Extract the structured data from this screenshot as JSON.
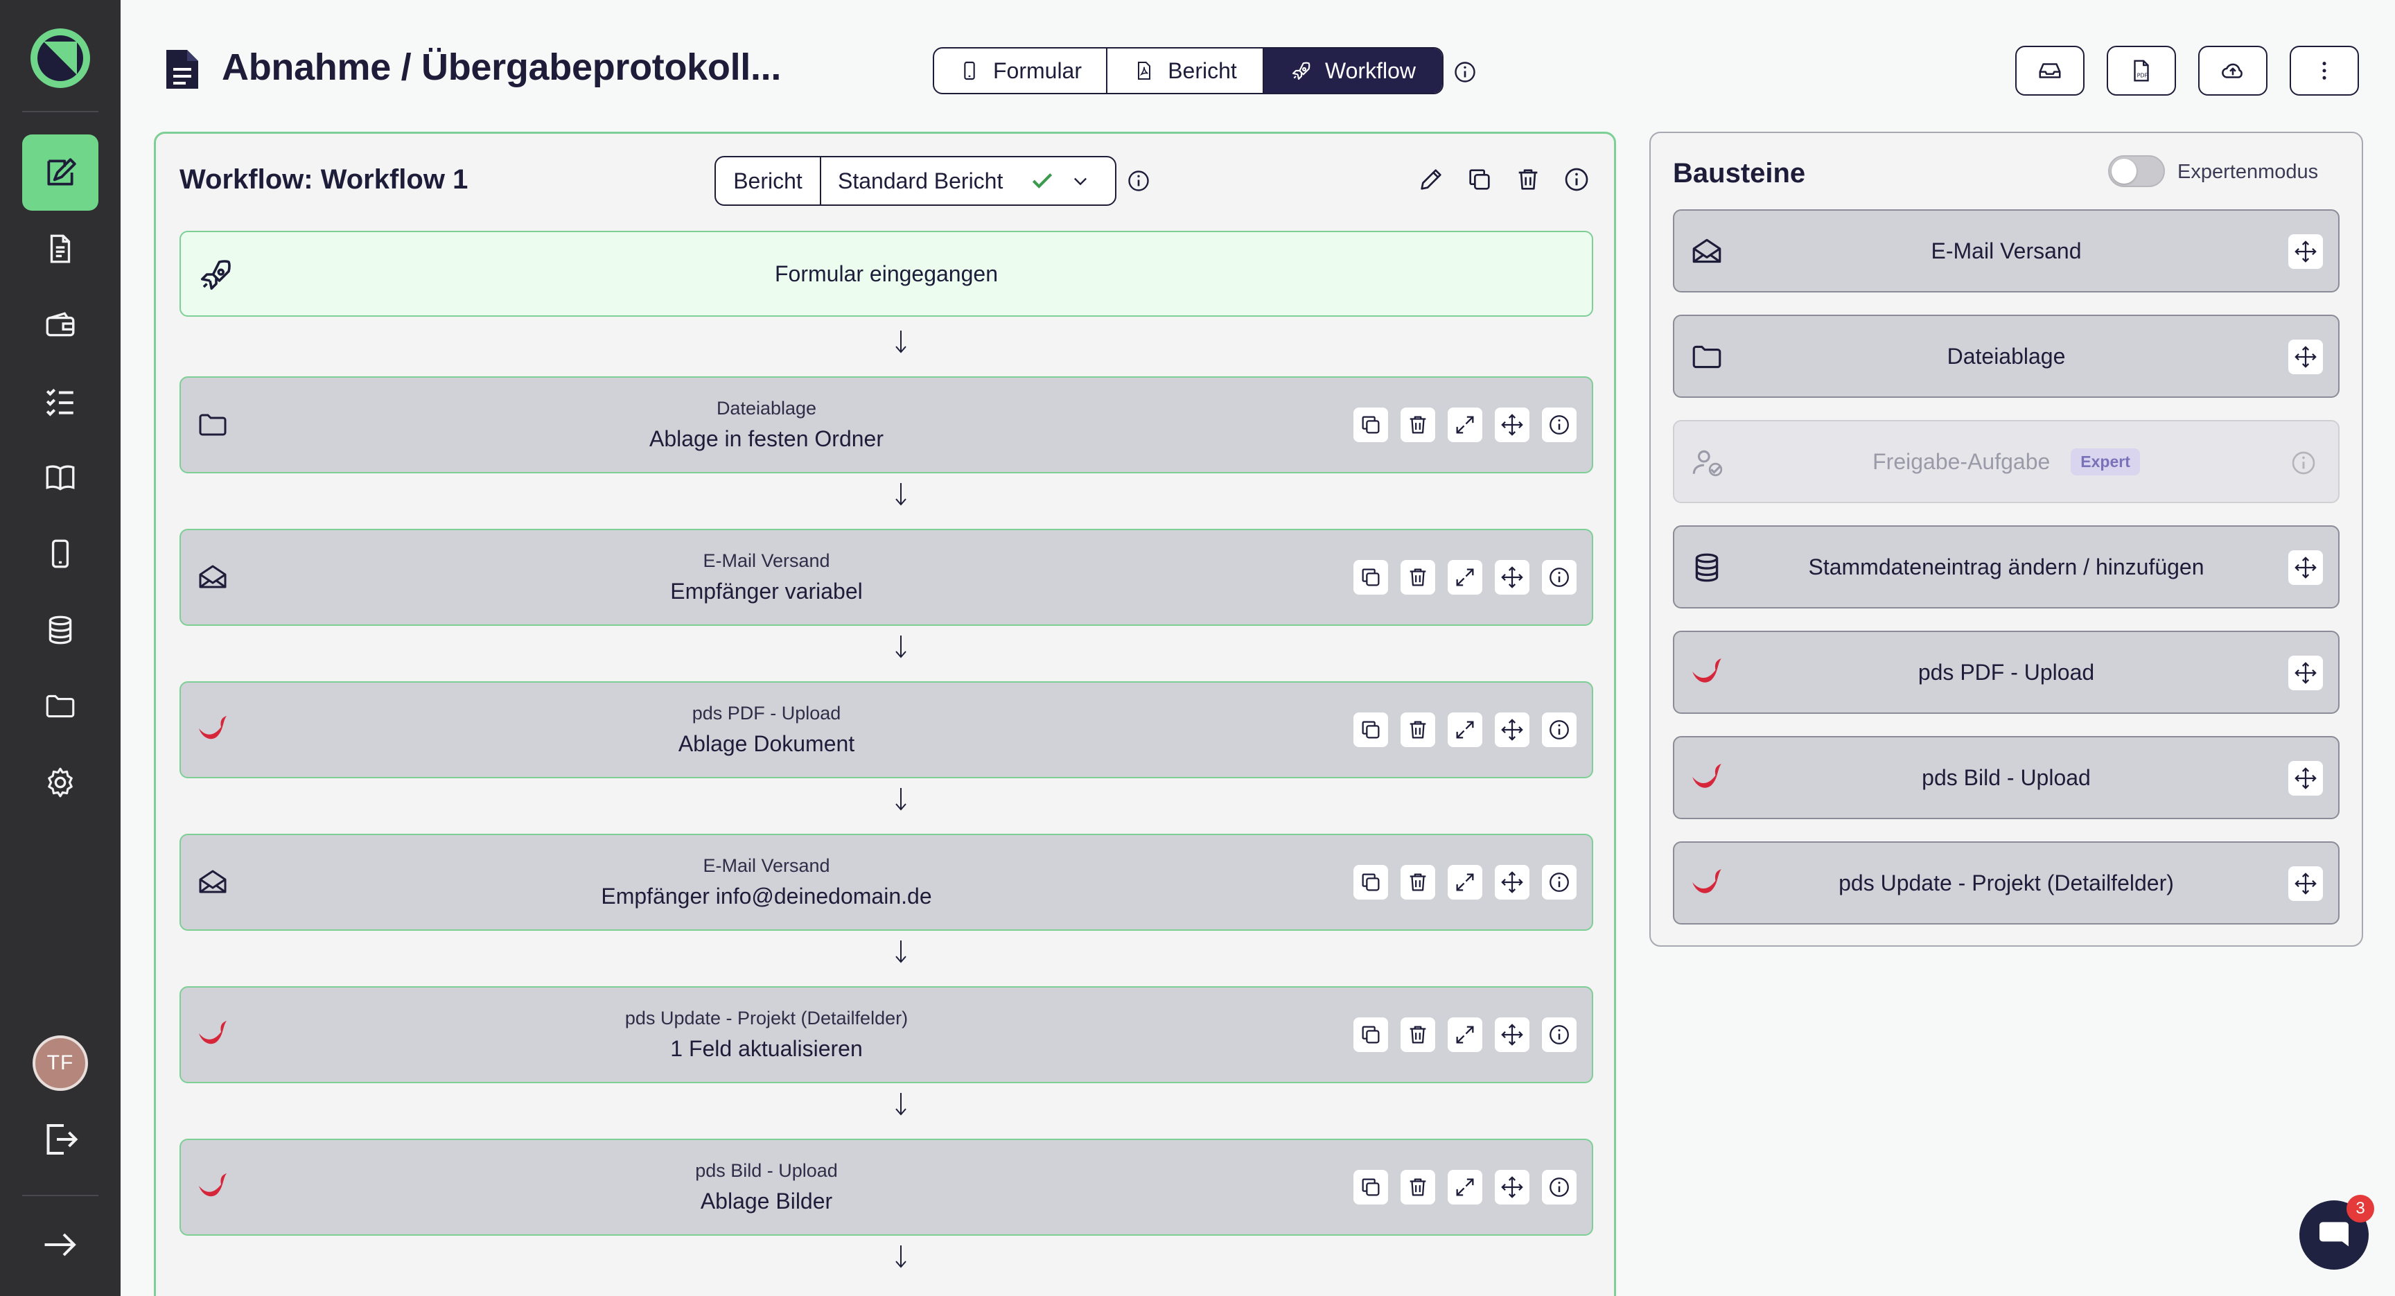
{
  "header": {
    "title": "Abnahme / Übergabeprotokoll...",
    "tabs": [
      {
        "label": "Formular",
        "icon": "phone-icon"
      },
      {
        "label": "Bericht",
        "icon": "pdf-file-icon"
      },
      {
        "label": "Workflow",
        "icon": "rocket-icon",
        "active": true
      }
    ],
    "actions": [
      "inbox-icon",
      "pdf-export-icon",
      "cloud-upload-icon",
      "more-vertical-icon"
    ]
  },
  "sidebar": {
    "items": [
      "edit-form-icon",
      "document-icon",
      "wallet-icon",
      "checklist-icon",
      "book-icon",
      "phone-icon",
      "database-icon",
      "folder-icon",
      "settings-icon"
    ],
    "active_index": 0,
    "avatar_initials": "TF"
  },
  "workflow": {
    "title": "Workflow: Workflow 1",
    "report_label": "Bericht",
    "report_value": "Standard Bericht",
    "trigger": "Formular eingegangen",
    "steps": [
      {
        "type": "Dateiablage",
        "name": "Ablage in festen Ordner",
        "icon": "folder-icon"
      },
      {
        "type": "E-Mail Versand",
        "name": "Empfänger variabel",
        "icon": "mail-icon"
      },
      {
        "type": "pds PDF - Upload",
        "name": "Ablage Dokument",
        "icon": "pds-logo-icon"
      },
      {
        "type": "E-Mail Versand",
        "name": "Empfänger info@deinedomain.de",
        "icon": "mail-icon"
      },
      {
        "type": "pds Update - Projekt (Detailfelder)",
        "name": "1 Feld aktualisieren",
        "icon": "pds-logo-icon"
      },
      {
        "type": "pds Bild - Upload",
        "name": "Ablage Bilder",
        "icon": "pds-logo-icon"
      }
    ]
  },
  "bausteine": {
    "title": "Bausteine",
    "expert_mode_label": "Expertenmodus",
    "expert_mode_on": false,
    "items": [
      {
        "label": "E-Mail Versand",
        "icon": "mail-icon"
      },
      {
        "label": "Dateiablage",
        "icon": "folder-icon"
      },
      {
        "label": "Freigabe-Aufgabe",
        "icon": "user-approval-icon",
        "disabled": true,
        "badge": "Expert"
      },
      {
        "label": "Stammdateneintrag ändern / hinzufügen",
        "icon": "database-icon"
      },
      {
        "label": "pds PDF - Upload",
        "icon": "pds-logo-icon"
      },
      {
        "label": "pds Bild - Upload",
        "icon": "pds-logo-icon"
      },
      {
        "label": "pds Update - Projekt (Detailfelder)",
        "icon": "pds-logo-icon"
      }
    ]
  },
  "chat": {
    "unread": "3"
  },
  "colors": {
    "accent": "#6fd68a",
    "dark": "#23214a",
    "sidebar": "#2f2f32",
    "pds_red": "#d6263a"
  }
}
